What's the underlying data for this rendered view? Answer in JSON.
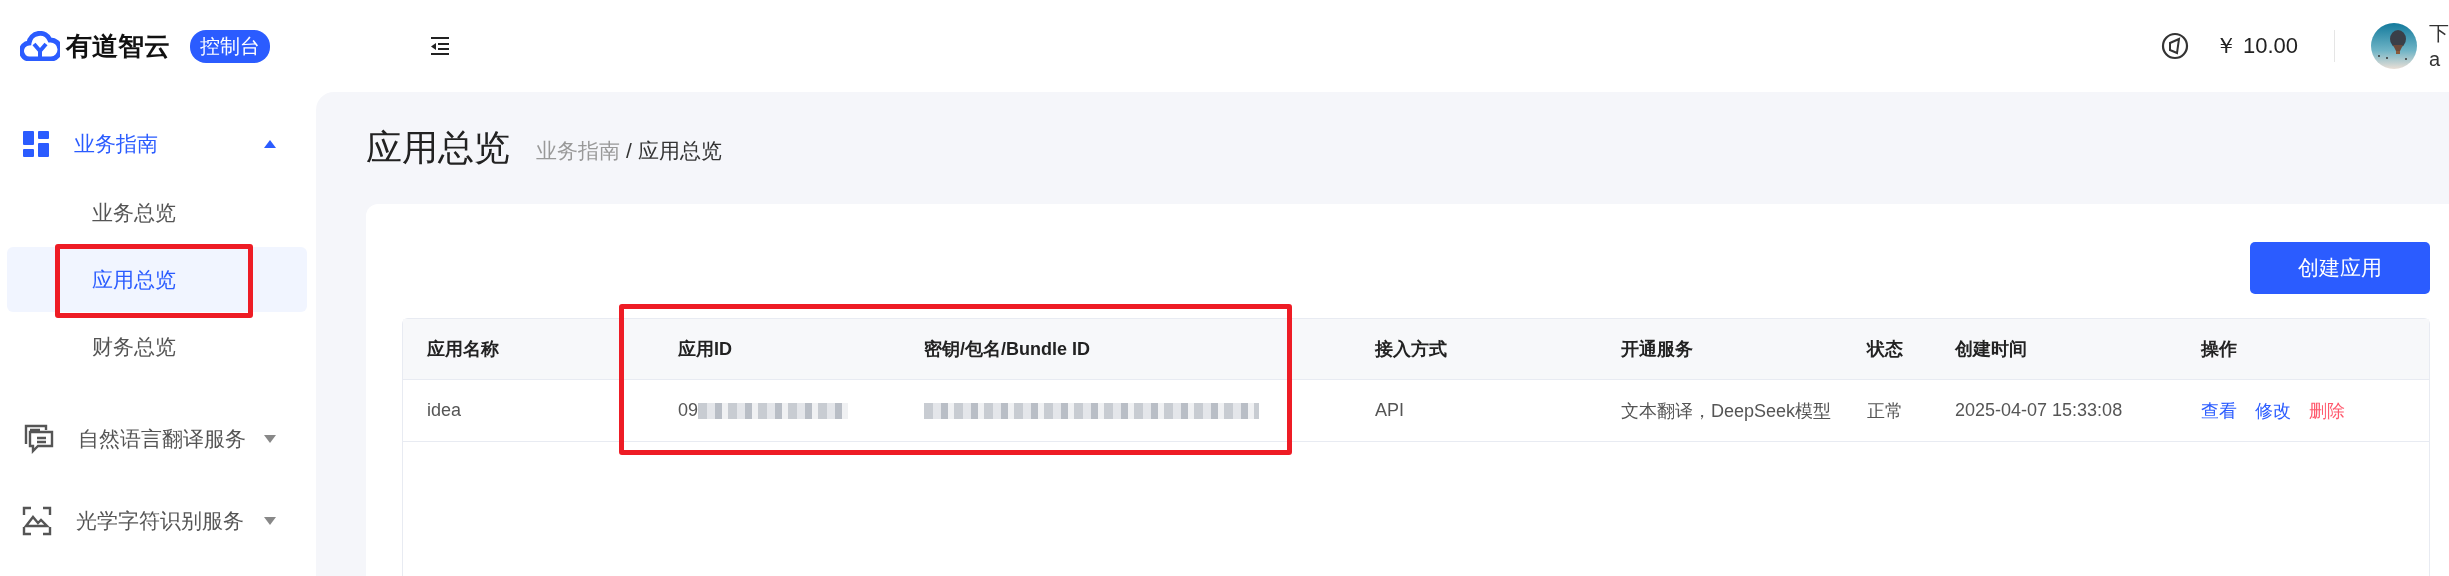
{
  "header": {
    "logo_text": "有道智云",
    "badge": "控制台",
    "balance": "￥ 10.00",
    "user_lines": [
      "下",
      "a"
    ]
  },
  "sidebar": {
    "groups": [
      {
        "label": "业务指南",
        "active": true,
        "expanded": true,
        "children": [
          {
            "label": "业务总览",
            "selected": false,
            "framed": false
          },
          {
            "label": "应用总览",
            "selected": true,
            "framed": true
          },
          {
            "label": "财务总览",
            "selected": false,
            "framed": false
          }
        ]
      },
      {
        "label": "自然语言翻译服务",
        "active": false,
        "expanded": false
      },
      {
        "label": "光学字符识别服务",
        "active": false,
        "expanded": false
      }
    ]
  },
  "page": {
    "title": "应用总览",
    "breadcrumb": [
      "业务指南",
      "应用总览"
    ],
    "breadcrumb_separator": "/",
    "create_button": "创建应用"
  },
  "table": {
    "columns": [
      {
        "label": "应用名称"
      },
      {
        "label": "应用ID",
        "framed": true
      },
      {
        "label": "密钥/包名/Bundle ID",
        "framed": true
      },
      {
        "label": "接入方式"
      },
      {
        "label": "开通服务"
      },
      {
        "label": "状态"
      },
      {
        "label": "创建时间"
      },
      {
        "label": "操作"
      }
    ],
    "rows": [
      {
        "cells": [
          {
            "kind": "text",
            "text": "idea"
          },
          {
            "kind": "redacted",
            "text": "09"
          },
          {
            "kind": "redacted"
          },
          {
            "kind": "text",
            "text": "API"
          },
          {
            "kind": "text",
            "text": "文本翻译，DeepSeek模型"
          },
          {
            "kind": "text",
            "text": "正常"
          },
          {
            "kind": "text",
            "text": "2025-04-07 15:33:08"
          },
          {
            "kind": "actions",
            "actions": [
              {
                "label": "查看",
                "color": "#2b5cff"
              },
              {
                "label": "修改",
                "color": "#2b5cff"
              },
              {
                "label": "删除",
                "color": "#ff5a6e"
              }
            ]
          }
        ]
      }
    ]
  }
}
